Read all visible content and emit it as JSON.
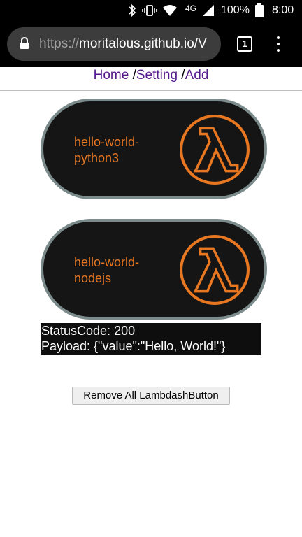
{
  "status_bar": {
    "network": "4G",
    "battery": "100%",
    "time": "8:00",
    "icons": [
      "bluetooth-icon",
      "vibrate-icon",
      "wifi-icon",
      "signal-icon",
      "battery-icon"
    ]
  },
  "browser": {
    "url_scheme": "https://",
    "url_host": "moritalous.github.io/V",
    "tab_count": "1"
  },
  "nav": {
    "home": "Home",
    "sep1": " /",
    "setting": "Setting",
    "sep2": " /",
    "add": "Add"
  },
  "lambda_buttons": [
    {
      "line1": "hello-world-",
      "line2": "python3",
      "icon": "aws-lambda-icon"
    },
    {
      "line1": "hello-world-",
      "line2": "nodejs",
      "icon": "aws-lambda-icon"
    }
  ],
  "result": {
    "status_line": "StatusCode: 200",
    "payload_line": "Payload: {\"value\":\"Hello, World!\"}"
  },
  "remove_button_label": "Remove All LambdashButton",
  "colors": {
    "accent": "#e87722",
    "button_bg": "#151515",
    "button_border": "#7b8a8a",
    "link": "#551a8b"
  }
}
